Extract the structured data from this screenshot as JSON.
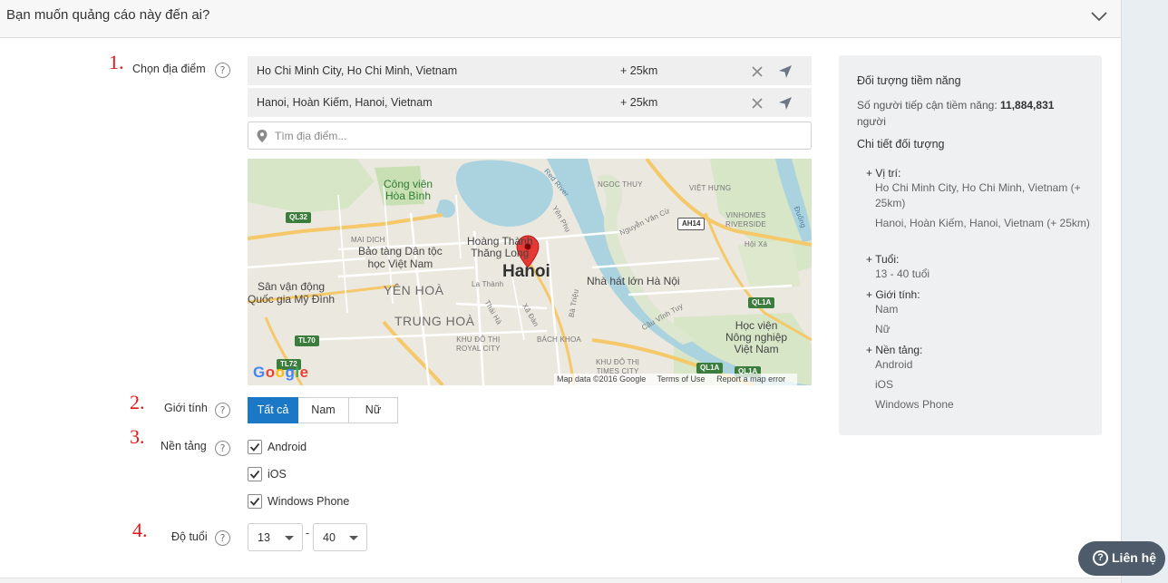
{
  "header": {
    "title": "Bạn muốn quảng cáo này đến ai?",
    "chevron_icon": "chevron-down-icon"
  },
  "steps": [
    "1.",
    "2.",
    "3.",
    "4."
  ],
  "location": {
    "label": "Chọn địa điểm",
    "help": "?",
    "items": [
      {
        "name": "Ho Chi Minh City, Ho Chi Minh, Vietnam",
        "radius": "+ 25km"
      },
      {
        "name": "Hanoi, Hoàn Kiếm, Hanoi, Vietnam",
        "radius": "+ 25km"
      }
    ],
    "search_placeholder": "Tìm địa điểm..."
  },
  "map": {
    "labels": {
      "park": "Công viên\nHòa Bình",
      "museum": "Bảo tàng Dân tộc\nhọc Việt Nam",
      "stadium": "Sân vận động\nQuốc gia Mỹ Đình",
      "mausoleum": "Hoàng Thành\nThăng Long",
      "hanoi": "Hanoi",
      "opera": "Nhà hát lớn Hà Nội",
      "academy": "Học viện\nNông nghiệp\nViệt Nam",
      "yenhoa": "YÊN HOÀ",
      "trunghoa": "TRUNG HOÀ",
      "maidich": "MAI DỊCH",
      "ngocthuy": "NGOC THUY",
      "viethung": "VIỆT HƯNG",
      "vinhomes": "VINHOMES\nRIVERSIDE",
      "khudothi_royal": "KHU ĐÔ THỊ\nROYAL CITY",
      "bachkhoa": "BÁCH KHOA",
      "khudothi_times": "KHU ĐÔ THỊ\nTIMES CITY",
      "lathanh": "La Thành",
      "yenphu": "Yên Phụ",
      "nguyenvancu": "Nguyễn Văn Cừ",
      "redriver": "Red River",
      "cauvinhtuy": "Cầu Vĩnh Tuy",
      "xadan": "Xã Đàn",
      "thaiha": "Thái Hà",
      "batrieu": "Bà Triệu",
      "hoixa": "Hội Xá",
      "duong": "Đuống"
    },
    "shields": [
      "QL32",
      "AH14",
      "QL1A",
      "TL70",
      "TL72",
      "QL1A",
      "QL1A"
    ],
    "footer": [
      "Map data ©2016 Google",
      "Terms of Use",
      "Report a map error"
    ],
    "logo": [
      "G",
      "o",
      "o",
      "g",
      "l",
      "e"
    ]
  },
  "gender": {
    "label": "Giới tính",
    "options": [
      "Tất cả",
      "Nam",
      "Nữ"
    ],
    "selected": "Tất cả"
  },
  "platform": {
    "label": "Nền tảng",
    "options": [
      {
        "label": "Android",
        "checked": true
      },
      {
        "label": "iOS",
        "checked": true
      },
      {
        "label": "Windows Phone",
        "checked": true
      }
    ]
  },
  "age": {
    "label": "Độ tuổi",
    "min": "13",
    "separator": "-",
    "max": "40"
  },
  "audience": {
    "title": "Đối tượng tiềm năng",
    "reach_label": "Số người tiếp cận tiềm năng:",
    "reach_value": "11,884,831",
    "reach_unit": "người",
    "details_title": "Chi tiết đối tượng",
    "location_heading": "+ Vị trí:",
    "location_values": [
      "Ho Chi Minh City, Ho Chi Minh, Vietnam  (+ 25km)",
      "Hanoi, Hoàn Kiếm, Hanoi, Vietnam  (+ 25km)"
    ],
    "age_heading": "+ Tuổi:",
    "age_value": "13 - 40 tuổi",
    "gender_heading": "+ Giới tính:",
    "gender_values": [
      "Nam",
      "Nữ"
    ],
    "platform_heading": "+ Nền tảng:",
    "platform_values": [
      "Android",
      "iOS",
      "Windows Phone"
    ]
  },
  "contact": {
    "label": "Liên hệ",
    "icon": "question-circle-icon"
  },
  "colors": {
    "accent": "#1b78c7",
    "step_number": "#e01818",
    "contact_bg": "#4d5b6a",
    "map_pin": "#e53935"
  }
}
